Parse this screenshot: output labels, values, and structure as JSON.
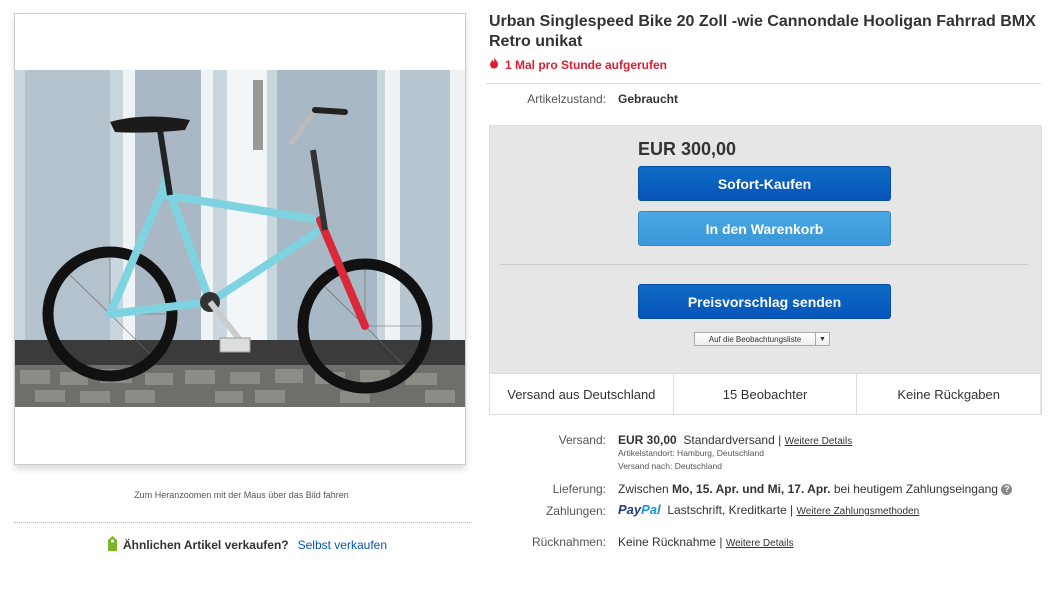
{
  "listing": {
    "title": "Urban Singlespeed Bike 20 Zoll -wie Cannondale Hooligan Fahrrad BMX Retro unikat",
    "views": "1 Mal pro Stunde aufgerufen",
    "condition_label": "Artikelzustand:",
    "condition_value": "Gebraucht"
  },
  "gallery": {
    "zoom_hint": "Zum Heranzoomen mit der Maus über das Bild fahren"
  },
  "sell_similar": {
    "question": "Ähnlichen Artikel verkaufen?",
    "link": "Selbst verkaufen"
  },
  "buybox": {
    "price": "EUR 300,00",
    "buy_now": "Sofort-Kaufen",
    "add_to_cart": "In den Warenkorb",
    "make_offer": "Preisvorschlag senden",
    "watchlist": "Auf die Beobachtungsliste",
    "facts": [
      "Versand aus Deutschland",
      "15 Beobachter",
      "Keine Rückgaben"
    ]
  },
  "details": {
    "shipping_label": "Versand:",
    "shipping_price": "EUR 30,00",
    "shipping_method": "Standardversand",
    "shipping_more": "Weitere Details",
    "location": "Artikelstandort:  Hamburg, Deutschland",
    "ships_to": "Versand nach:  Deutschland",
    "delivery_label": "Lieferung:",
    "delivery_pre": "Zwischen",
    "delivery_dates": "Mo, 15. Apr. und Mi, 17. Apr.",
    "delivery_post": "bei heutigem Zahlungseingang",
    "payments_label": "Zahlungen:",
    "paypal_a": "Pay",
    "paypal_b": "Pal",
    "payments_other": "Lastschrift,  Kreditkarte",
    "payments_more": "Weitere Zahlungsmethoden",
    "returns_label": "Rücknahmen:",
    "returns_value": "Keine Rücknahme",
    "returns_more": "Weitere Details"
  },
  "colors": {
    "accent_blue": "#0654ba",
    "alert_red": "#dd1e31",
    "bike_frame": "#7fd3e0",
    "fork_red": "#d8283a"
  }
}
